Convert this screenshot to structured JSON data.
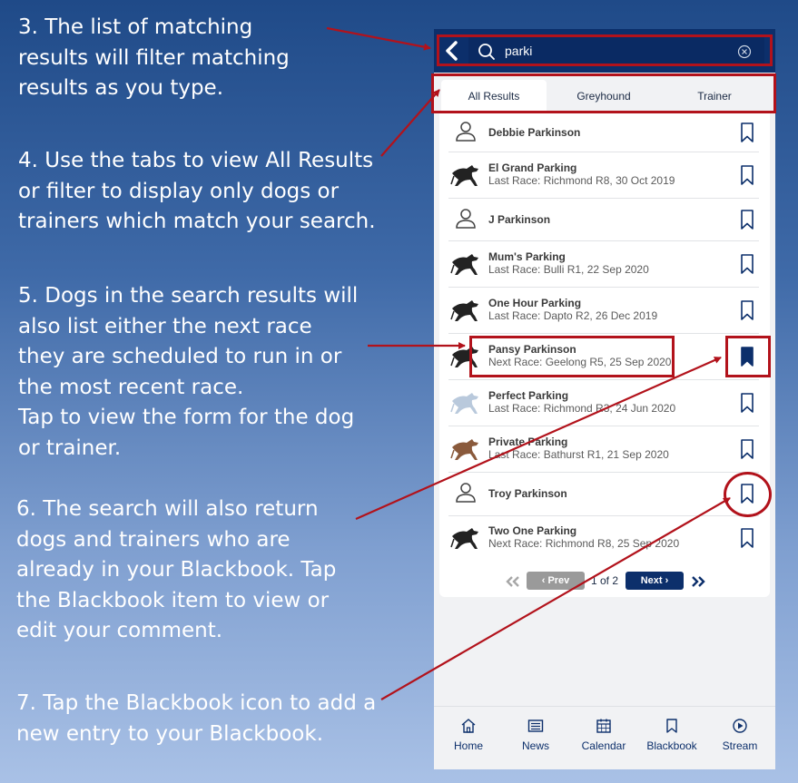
{
  "annotations": [
    "3. The list of matching\nresults will filter matching\nresults as you type.",
    "4. Use the tabs to view All Results\nor filter to display only dogs or\ntrainers which match your search.",
    "5. Dogs in the search results will\nalso list either the next race\nthey are scheduled to run in or\nthe most recent race.\nTap to view the form for the dog\nor trainer.",
    "6. The search will also return\ndogs and trainers who are\nalready in your Blackbook. Tap\nthe Blackbook item to view or\nedit your comment.",
    "7. Tap the Blackbook icon to add a\nnew entry to your Blackbook."
  ],
  "search": {
    "value": "parki",
    "icon": "search-icon"
  },
  "tabs": [
    {
      "label": "All Results",
      "active": true
    },
    {
      "label": "Greyhound",
      "active": false
    },
    {
      "label": "Trainer",
      "active": false
    }
  ],
  "results": [
    {
      "type": "trainer",
      "name": "Debbie Parkinson",
      "sub": "",
      "saved": false
    },
    {
      "type": "dog",
      "name": "El Grand Parking",
      "sub": "Last Race: Richmond R8, 30 Oct 2019",
      "saved": false
    },
    {
      "type": "trainer",
      "name": "J Parkinson",
      "sub": "",
      "saved": false
    },
    {
      "type": "dog",
      "name": "Mum's Parking",
      "sub": "Last Race: Bulli R1, 22 Sep 2020",
      "saved": false
    },
    {
      "type": "dog",
      "name": "One Hour Parking",
      "sub": "Last Race: Dapto R2, 26 Dec 2019",
      "saved": false
    },
    {
      "type": "dog",
      "name": "Pansy Parkinson",
      "sub": "Next Race: Geelong R5, 25 Sep 2020",
      "saved": true
    },
    {
      "type": "dog",
      "name": "Perfect Parking",
      "sub": "Last Race: Richmond R3, 24 Jun 2020",
      "saved": false
    },
    {
      "type": "dog",
      "name": "Private Parking",
      "sub": "Last Race: Bathurst R1, 21 Sep 2020",
      "saved": false
    },
    {
      "type": "trainer",
      "name": "Troy Parkinson",
      "sub": "",
      "saved": false
    },
    {
      "type": "dog",
      "name": "Two One Parking",
      "sub": "Next Race: Richmond R8, 25 Sep 2020",
      "saved": false
    }
  ],
  "pagination": {
    "prev_label": "Prev",
    "next_label": "Next",
    "page_text": "1 of 2"
  },
  "bottom_nav": [
    {
      "label": "Home",
      "icon": "home-icon"
    },
    {
      "label": "News",
      "icon": "news-icon"
    },
    {
      "label": "Calendar",
      "icon": "calendar-icon"
    },
    {
      "label": "Blackbook",
      "icon": "bookmark-icon"
    },
    {
      "label": "Stream",
      "icon": "play-icon"
    }
  ],
  "colors": {
    "brand_navy": "#0c2f6b",
    "annotation_red": "#b2121b",
    "text_dark": "#3a3a3a",
    "text_sub": "#5b5b5b"
  }
}
